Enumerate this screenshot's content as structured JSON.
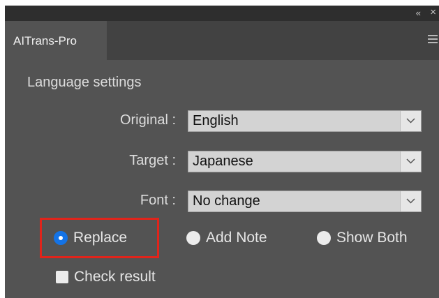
{
  "window": {
    "collapse_glyph": "«",
    "close_glyph": "×"
  },
  "tab": {
    "label": "AITrans-Pro"
  },
  "section": {
    "title": "Language settings"
  },
  "fields": [
    {
      "label": "Original :",
      "value": "English"
    },
    {
      "label": "Target :",
      "value": "Japanese"
    },
    {
      "label": "Font :",
      "value": "No change"
    }
  ],
  "modes": [
    {
      "label": "Replace",
      "selected": true
    },
    {
      "label": "Add Note",
      "selected": false
    },
    {
      "label": "Show Both",
      "selected": false
    }
  ],
  "check_result": {
    "label": "Check result",
    "checked": false
  },
  "colors": {
    "panel_bg": "#535353",
    "accent_blue": "#1473e6",
    "highlight_red": "#e0241b"
  }
}
